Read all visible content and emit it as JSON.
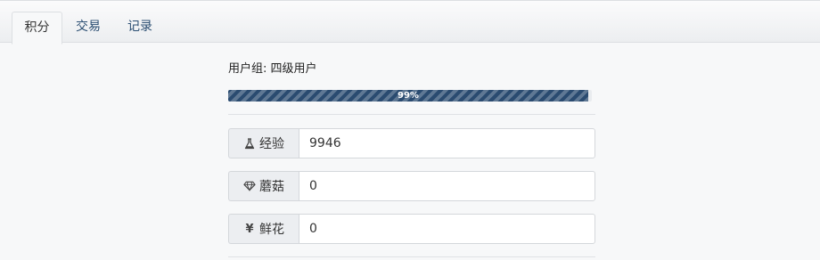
{
  "tabs": [
    {
      "label": "积分",
      "active": true
    },
    {
      "label": "交易",
      "active": false
    },
    {
      "label": "记录",
      "active": false
    }
  ],
  "user_group": "用户组: 四级用户",
  "progress": {
    "value": 99,
    "label": "99%"
  },
  "fields": [
    {
      "icon": "flask-icon",
      "label": "经验",
      "value": "9946"
    },
    {
      "icon": "diamond-icon",
      "label": "蘑菇",
      "value": "0"
    },
    {
      "icon": "yen-icon",
      "label": "鲜花",
      "value": "0"
    }
  ],
  "colors": {
    "accent": "#2a4b70",
    "tab_text": "#2b4e72"
  }
}
